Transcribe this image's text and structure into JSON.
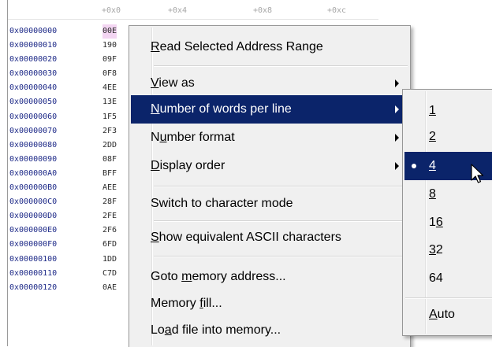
{
  "memory": {
    "header_offsets": [
      "+0x0",
      "+0x4",
      "+0x8",
      "+0xc"
    ],
    "rows": [
      {
        "addr": "0x00000000",
        "val": "00E"
      },
      {
        "addr": "0x00000010",
        "val": "190"
      },
      {
        "addr": "0x00000020",
        "val": "09F"
      },
      {
        "addr": "0x00000030",
        "val": "0F8"
      },
      {
        "addr": "0x00000040",
        "val": "4EE"
      },
      {
        "addr": "0x00000050",
        "val": "13E"
      },
      {
        "addr": "0x00000060",
        "val": "1F5"
      },
      {
        "addr": "0x00000070",
        "val": "2F3"
      },
      {
        "addr": "0x00000080",
        "val": "2DD"
      },
      {
        "addr": "0x00000090",
        "val": "08F"
      },
      {
        "addr": "0x000000A0",
        "val": "BFF"
      },
      {
        "addr": "0x000000B0",
        "val": "AEE"
      },
      {
        "addr": "0x000000C0",
        "val": "28F"
      },
      {
        "addr": "0x000000D0",
        "val": "2FE"
      },
      {
        "addr": "0x000000E0",
        "val": "2F6"
      },
      {
        "addr": "0x000000F0",
        "val": "6FD"
      },
      {
        "addr": "0x00000100",
        "val": "1DD"
      },
      {
        "addr": "0x00000110",
        "val": "C7D"
      },
      {
        "addr": "0x00000120",
        "val": "0AE"
      }
    ]
  },
  "context_menu": {
    "read_range": {
      "pre": "",
      "key": "R",
      "post": "ead Selected Address Range"
    },
    "view_as": {
      "pre": "",
      "key": "V",
      "post": "iew as"
    },
    "words_per_line": {
      "pre": "",
      "key": "N",
      "post": "umber of words per line"
    },
    "number_format": {
      "pre": "N",
      "key": "u",
      "post": "mber format"
    },
    "display_order": {
      "pre": "",
      "key": "D",
      "post": "isplay order"
    },
    "char_mode": {
      "pre": "Switch to character mode",
      "key": "",
      "post": ""
    },
    "show_ascii": {
      "pre": "",
      "key": "S",
      "post": "how equivalent ASCII characters"
    },
    "goto_address": {
      "pre": "Goto ",
      "key": "m",
      "post": "emory address..."
    },
    "memory_fill": {
      "pre": "Memory ",
      "key": "f",
      "post": "ill..."
    },
    "load_file": {
      "pre": "Lo",
      "key": "a",
      "post": "d file into memory..."
    }
  },
  "submenu": {
    "selected": "4",
    "opt_1": {
      "key": "1",
      "post": ""
    },
    "opt_2": {
      "key": "2",
      "post": ""
    },
    "opt_4": {
      "key": "4",
      "post": ""
    },
    "opt_8": {
      "key": "8",
      "post": ""
    },
    "opt_16": {
      "pre": "1",
      "key": "6",
      "post": ""
    },
    "opt_32": {
      "key": "3",
      "post": "2"
    },
    "opt_64": {
      "pre": "64",
      "key": "",
      "post": ""
    },
    "auto": {
      "key": "A",
      "post": "uto"
    }
  },
  "colors": {
    "highlight": "#0b246a",
    "address_text": "#1e2a88",
    "selection": "#f3d5f2",
    "menu_bg": "#f0f0f0"
  },
  "icons": {
    "submenu_arrow": "triangle-right",
    "checked": "bullet",
    "cursor": "arrow-pointer"
  }
}
